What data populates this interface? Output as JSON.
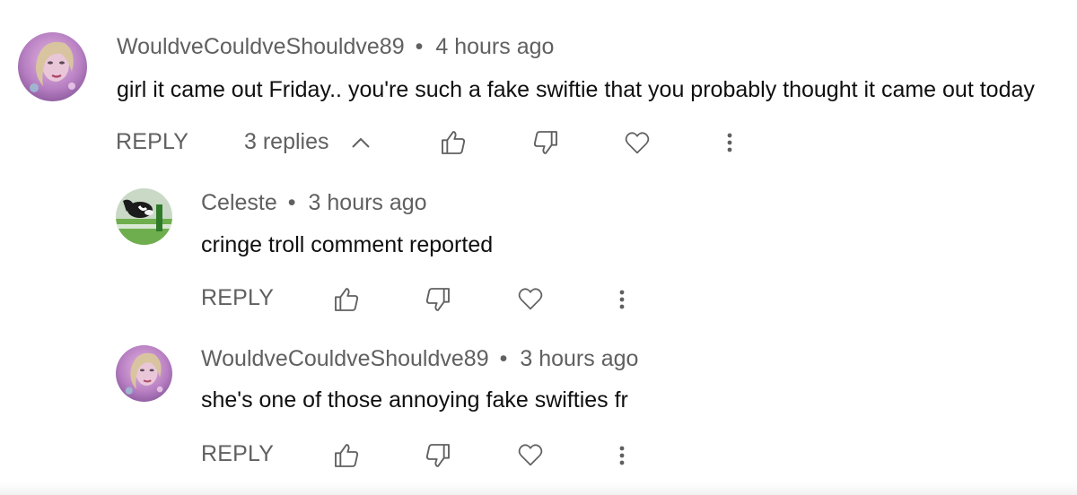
{
  "comments": [
    {
      "author": "WouldveCouldveShouldve89",
      "time": "4 hours ago",
      "text": "girl it came out Friday.. you're such a fake swiftie that you probably thought it came out today",
      "reply_label": "REPLY",
      "replies_label": "3 replies",
      "avatar": "profile-photo-icon"
    },
    {
      "author": "Celeste",
      "time": "3 hours ago",
      "text": "cringe troll comment reported",
      "reply_label": "REPLY",
      "avatar": "profile-photo-icon"
    },
    {
      "author": "WouldveCouldveShouldve89",
      "time": "3 hours ago",
      "text": "she's one of those annoying fake swifties fr",
      "reply_label": "REPLY",
      "avatar": "profile-photo-icon"
    }
  ],
  "separator": "•",
  "icons": {
    "like": "thumbs-up-icon",
    "dislike": "thumbs-down-icon",
    "heart": "heart-icon",
    "more": "more-vertical-icon",
    "toggle": "chevron-up-icon"
  },
  "colors": {
    "text": "#0f0f0f",
    "secondary": "#606060"
  }
}
